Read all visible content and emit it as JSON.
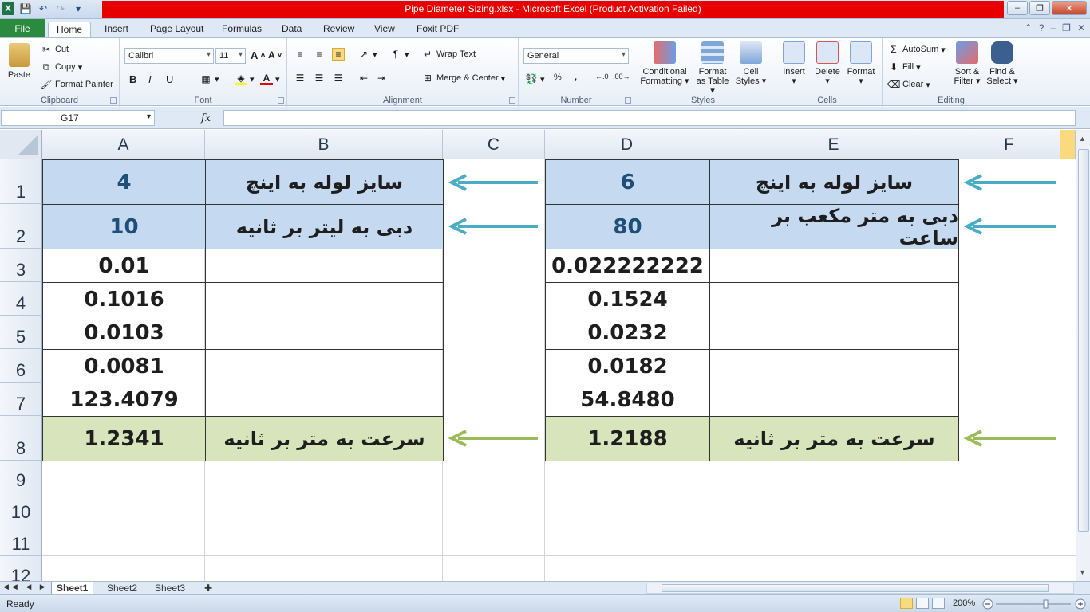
{
  "window": {
    "title": "Pipe Diameter Sizing.xlsx  -  Microsoft Excel (Product Activation Failed)",
    "app_logo": "X"
  },
  "tabs": [
    "File",
    "Home",
    "Insert",
    "Page Layout",
    "Formulas",
    "Data",
    "Review",
    "View",
    "Foxit PDF"
  ],
  "ribbon": {
    "clipboard": {
      "paste": "Paste",
      "cut": "Cut",
      "copy": "Copy",
      "format_painter": "Format Painter",
      "label": "Clipboard"
    },
    "font": {
      "name": "Calibri",
      "size": "11",
      "label": "Font",
      "bold": "B",
      "italic": "I",
      "underline": "U"
    },
    "alignment": {
      "wrap_text": "Wrap Text",
      "merge_center": "Merge & Center",
      "label": "Alignment"
    },
    "number": {
      "format": "General",
      "percent": "%",
      "comma": ",",
      "label": "Number"
    },
    "styles": {
      "conditional": "Conditional",
      "formatting": "Formatting",
      "format_as": "Format",
      "as_table": "as Table",
      "cell": "Cell",
      "styles": "Styles",
      "label": "Styles"
    },
    "cells": {
      "insert": "Insert",
      "delete": "Delete",
      "format": "Format",
      "label": "Cells"
    },
    "editing": {
      "autosum": "AutoSum",
      "fill": "Fill",
      "clear": "Clear",
      "sort": "Sort &",
      "filter": "Filter",
      "find": "Find &",
      "select": "Select",
      "label": "Editing"
    }
  },
  "formula_bar": {
    "name_box": "G17",
    "fx": "fx",
    "formula": ""
  },
  "columns": [
    "A",
    "B",
    "C",
    "D",
    "E",
    "F"
  ],
  "rows": [
    "1",
    "2",
    "3",
    "4",
    "5",
    "6",
    "7",
    "8",
    "9",
    "10",
    "11",
    "12"
  ],
  "cells": {
    "A1": "4",
    "B1": "سایز لوله به اینچ",
    "D1": "6",
    "E1": "سایز لوله به اینچ",
    "A2": "10",
    "B2": "دبی به لیتر بر ثانیه",
    "D2": "80",
    "E2": "دبی به متر مکعب بر ساعت",
    "A3": "0.01",
    "D3": "0.022222222",
    "A4": "0.1016",
    "D4": "0.1524",
    "A5": "0.0103",
    "D5": "0.0232",
    "A6": "0.0081",
    "D6": "0.0182",
    "A7": "123.4079",
    "D7": "54.8480",
    "A8": "1.2341",
    "B8": "سرعت به متر بر ثانیه",
    "D8": "1.2188",
    "E8": "سرعت به متر بر ثانیه"
  },
  "sheets": [
    "Sheet1",
    "Sheet2",
    "Sheet3"
  ],
  "status": {
    "ready": "Ready",
    "zoom": "200%"
  },
  "colors": {
    "input_fill": "#c5d9f1",
    "result_fill": "#d8e4bc",
    "blue_arrow": "#4bacc6",
    "green_arrow": "#9bbb59",
    "title_bar_red": "#e60000"
  }
}
